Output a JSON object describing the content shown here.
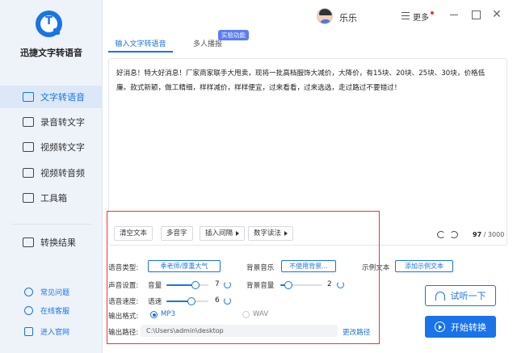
{
  "app": {
    "name": "迅捷文字转语音",
    "logo_letter": "T"
  },
  "sidebar": {
    "items": [
      {
        "label": "文字转语音",
        "icon": "text-to-speech-icon",
        "active": true
      },
      {
        "label": "录音转文字",
        "icon": "recording-to-text-icon"
      },
      {
        "label": "视频转文字",
        "icon": "video-to-text-icon"
      },
      {
        "label": "视频转音频",
        "icon": "video-to-audio-icon"
      },
      {
        "label": "工具箱",
        "icon": "toolbox-icon"
      },
      {
        "label": "转换结果",
        "icon": "result-icon"
      }
    ],
    "bottom_links": [
      {
        "label": "常见问题",
        "icon": "faq-icon"
      },
      {
        "label": "在线客服",
        "icon": "chat-icon"
      },
      {
        "label": "进入官网",
        "icon": "website-icon"
      }
    ]
  },
  "header": {
    "username": "乐乐",
    "more_label": "更多"
  },
  "tabs": [
    {
      "label": "输入文字转语音",
      "active": true
    },
    {
      "label": "多人播报",
      "badge": "实验功能"
    }
  ],
  "editor": {
    "content": "好消息！特大好消息！厂家商家联手大甩卖，现将一批高档服饰大减价，大降价，有15块、20块、25块、30块，价格低廉。款式新颖，做工精细，样样减价，样样便宜，过来看看，过来选选，走过路过不要错过！",
    "toolbar": [
      "清空文本",
      "多音字",
      "插入间隔",
      "数字读法"
    ],
    "count_current": "97",
    "count_max": " / 3000"
  },
  "settings": {
    "voice_type_label": "语音类型:",
    "voice_type_value": "季老师/厚重大气",
    "bgm_label": "背景音乐",
    "bgm_value": "不使用背景...",
    "sample_label": "示例文本",
    "sample_button": "添加示例文本",
    "sound_label": "声音设置:",
    "volume_label": "音量",
    "volume_value": "7",
    "volume_level": 0.7,
    "bg_volume_label": "背景音量",
    "bg_volume_value": "2",
    "bg_volume_level": 0.2,
    "speed_label": "语音速度:",
    "rate_label": "语速",
    "rate_value": "6",
    "rate_level": 0.6,
    "format_label": "输出格式:",
    "format_options": [
      "MP3",
      "WAV"
    ],
    "format_selected": "MP3",
    "path_label": "输出路径:",
    "path_value": "C:\\Users\\admin\\desktop",
    "change_path": "更改路径"
  },
  "actions": {
    "try_label": "试听一下",
    "start_label": "开始转换"
  },
  "colors": {
    "accent": "#1a73e8",
    "highlight": "#e53935",
    "sidebar_bg": "#eef3fa"
  }
}
